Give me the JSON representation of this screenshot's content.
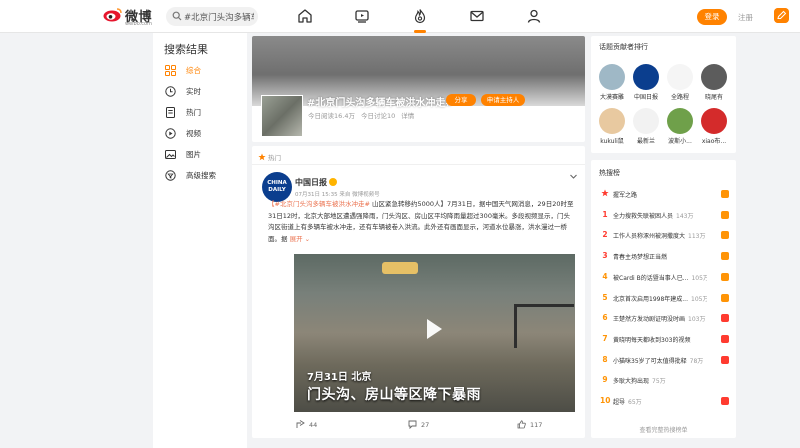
{
  "brand": {
    "name": "微博",
    "sub": "weibo.com"
  },
  "search": {
    "value": "#北京门头沟多辆车被洪水冲走#",
    "display": "#北京门头沟多辆车被洪"
  },
  "nav": {
    "login": "登录",
    "register": "注册"
  },
  "colors": {
    "accent": "#ff8200",
    "hot_red": "#ff3b30",
    "hot_orange": "#ff9406",
    "link": "#eb7350"
  },
  "left": {
    "title": "搜索结果",
    "items": [
      {
        "label": "综合",
        "icon": "grid-icon"
      },
      {
        "label": "实时",
        "icon": "clock-icon"
      },
      {
        "label": "热门",
        "icon": "document-icon"
      },
      {
        "label": "视频",
        "icon": "play-circle-icon"
      },
      {
        "label": "图片",
        "icon": "image-icon"
      },
      {
        "label": "高级搜索",
        "icon": "filter-icon"
      }
    ]
  },
  "hero": {
    "title": "#北京门头沟多辆车被洪水冲走#",
    "tags": [
      "分享",
      "申请主持人"
    ],
    "reads": "今日阅读16.4万",
    "discuss": "今日讨论10",
    "detail": "详情"
  },
  "post": {
    "section": "热门",
    "author": "中国日报",
    "avatar_text": "CHINA DAILY",
    "meta": "07月31日 15:35  来自 微博视频号",
    "text_hl": "【#北京门头沟多辆车被洪水冲走#",
    "text_body": " 山区紧急转移约5000人】7月31日，据中国天气网消息，29日20时至31日12时，北京大部地区遭遇强降雨，门头沟区、房山区平均降雨量超过300毫米。多段视频显示，门头沟区街道上有多辆车被水冲走，还有车辆被卷入洪流。此外还有画面显示，河道水位暴涨，洪水漫过一桥面。据 ",
    "more": "展开",
    "video_caption1": "7月31日 北京",
    "video_caption2": "门头沟、房山等区降下暴雨",
    "actions": {
      "share": "44",
      "comment": "27",
      "like": "117"
    }
  },
  "right": {
    "contrib_title": "话题贡献者排行",
    "contributors": [
      {
        "name": "大漠赛雕",
        "color": "#9fb8c6"
      },
      {
        "name": "中国日报",
        "color": "#0b3e8e"
      },
      {
        "name": "全路程",
        "color": "#f5f5f5"
      },
      {
        "name": "晓尾有",
        "color": "#5c5c5c"
      },
      {
        "name": "kukuli鼠",
        "color": "#e8c9a0"
      },
      {
        "name": "最新兰",
        "color": "#f2f2f2"
      },
      {
        "name": "波斯小...",
        "color": "#6fa04a"
      },
      {
        "name": "xiao布...",
        "color": "#d42b2b"
      }
    ],
    "hot_title": "热搜榜",
    "hot": [
      {
        "rank": "",
        "text": "握军之路",
        "count": "",
        "badge": "#ff9406"
      },
      {
        "rank": "1",
        "text": "全力搜救失联被困人员",
        "count": "143万",
        "badge": "#ff9406"
      },
      {
        "rank": "2",
        "text": "工作人员称涿州被洞撒度大",
        "count": "113万",
        "badge": "#ff9406"
      },
      {
        "rank": "3",
        "text": "青春主场梦想正当燃",
        "count": "",
        "badge": "#ff9406"
      },
      {
        "rank": "4",
        "text": "被Cardi B的话暨当事人已...",
        "count": "105万",
        "badge": "#ff9406"
      },
      {
        "rank": "5",
        "text": "北京首次启用1998年建成...",
        "count": "105万",
        "badge": "#ff9406"
      },
      {
        "rank": "6",
        "text": "王楚然方发动剧证明没时画",
        "count": "103万",
        "badge": "#ff3b30"
      },
      {
        "rank": "7",
        "text": "黄晓明每天都收到303的视频",
        "count": "",
        "badge": "#ff3b30"
      },
      {
        "rank": "8",
        "text": "小猫咪35岁了可太值得批释",
        "count": "78万",
        "badge": "#ff3b30"
      },
      {
        "rank": "9",
        "text": "多耿大狗出现",
        "count": "75万",
        "badge": ""
      },
      {
        "rank": "10",
        "text": "超导",
        "count": "65万",
        "badge": "#ff3b30"
      }
    ],
    "hot_more": "查看完整热搜榜单"
  }
}
